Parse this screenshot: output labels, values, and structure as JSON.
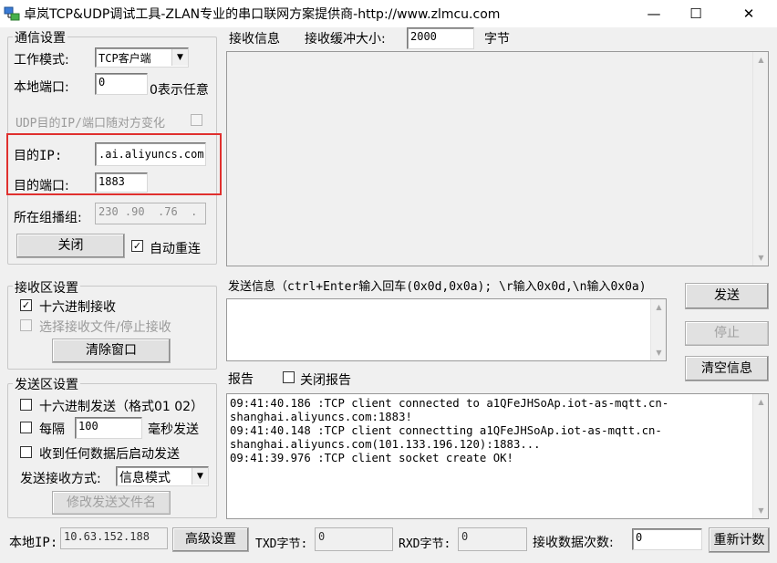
{
  "window": {
    "title": "卓岚TCP&UDP调试工具-ZLAN专业的串口联网方案提供商-http://www.zlmcu.com",
    "minimize": "—",
    "maximize": "☐",
    "close": "✕"
  },
  "comm": {
    "legend": "通信设置",
    "mode_label": "工作模式:",
    "mode_value": "TCP客户端",
    "local_port_label": "本地端口:",
    "local_port_value": "0",
    "local_port_hint": "0表示任意",
    "udp_follow_label": "UDP目的IP/端口随对方变化",
    "dest_ip_label": "目的IP:",
    "dest_ip_value": ".ai.aliyuncs.com",
    "dest_port_label": "目的端口:",
    "dest_port_value": "1883",
    "group_label": "所在组播组:",
    "group_value": "230 .90  .76  . 1",
    "close_button": "关闭",
    "auto_reconnect_label": "自动重连",
    "auto_reconnect_checked": "✓"
  },
  "recv_settings": {
    "legend": "接收区设置",
    "hex_recv_label": "十六进制接收",
    "hex_recv_checked": "✓",
    "save_file_label": "选择接收文件/停止接收",
    "clear_button": "清除窗口"
  },
  "send_settings": {
    "legend": "发送区设置",
    "hex_send_label": "十六进制发送（格式01 02）",
    "every_label": "每隔",
    "every_value": "100",
    "ms_send_label": "毫秒发送",
    "auto_send_label": "收到任何数据后启动发送",
    "method_label": "发送接收方式:",
    "method_value": "信息模式",
    "modify_file_button": "修改发送文件名"
  },
  "recv_area": {
    "label": "接收信息",
    "buffer_label": "接收缓冲大小:",
    "buffer_value": "2000",
    "buffer_unit": "字节"
  },
  "send_area": {
    "label": "发送信息（ctrl+Enter输入回车(0x0d,0x0a); \\r输入0x0d,\\n输入0x0a)",
    "send_button": "发送",
    "stop_button": "停止",
    "clear_info_button": "清空信息"
  },
  "report": {
    "label": "报告",
    "close_report_label": "关闭报告",
    "lines": [
      "09:41:40.186 :TCP client connected to a1QFeJHSoAp.iot-as-mqtt.cn-",
      "shanghai.aliyuncs.com:1883!",
      "09:41:40.148 :TCP client connectting a1QFeJHSoAp.iot-as-mqtt.cn-",
      "shanghai.aliyuncs.com(101.133.196.120):1883...",
      "09:41:39.976 :TCP client socket create OK!"
    ]
  },
  "status": {
    "local_ip_label": "本地IP:",
    "local_ip_value": "10.63.152.188",
    "advanced_button": "高级设置",
    "txd_label": "TXD字节:",
    "txd_value": "0",
    "rxd_label": "RXD字节:",
    "rxd_value": "0",
    "recv_count_label": "接收数据次数:",
    "recv_count_value": "0",
    "recount_button": "重新计数"
  },
  "scroll": {
    "up": "▲",
    "down": "▼",
    "combo": "▼"
  }
}
